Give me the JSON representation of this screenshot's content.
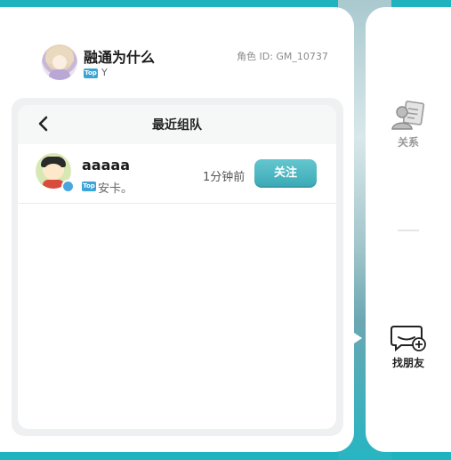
{
  "header": {
    "username": "融通为什么",
    "badge": "Top",
    "subtitle": "Y",
    "role_id": "角色 ID: GM_10737"
  },
  "recent_team": {
    "title": "最近组队",
    "entries": [
      {
        "name": "aaaaa",
        "badge": "Top",
        "status": "安卡。",
        "time_ago": "1分钟前",
        "action": "关注"
      }
    ]
  },
  "side_nav": {
    "relations_label": "关系",
    "find_friends_label": "找朋友"
  },
  "colors": {
    "accent": "#3aa9b5",
    "background": "#1fb3c0",
    "badge": "#3ba3d6"
  },
  "icons": {
    "back": "chevron-left-icon",
    "relations": "contacts-icon",
    "find_friends": "add-message-icon"
  }
}
